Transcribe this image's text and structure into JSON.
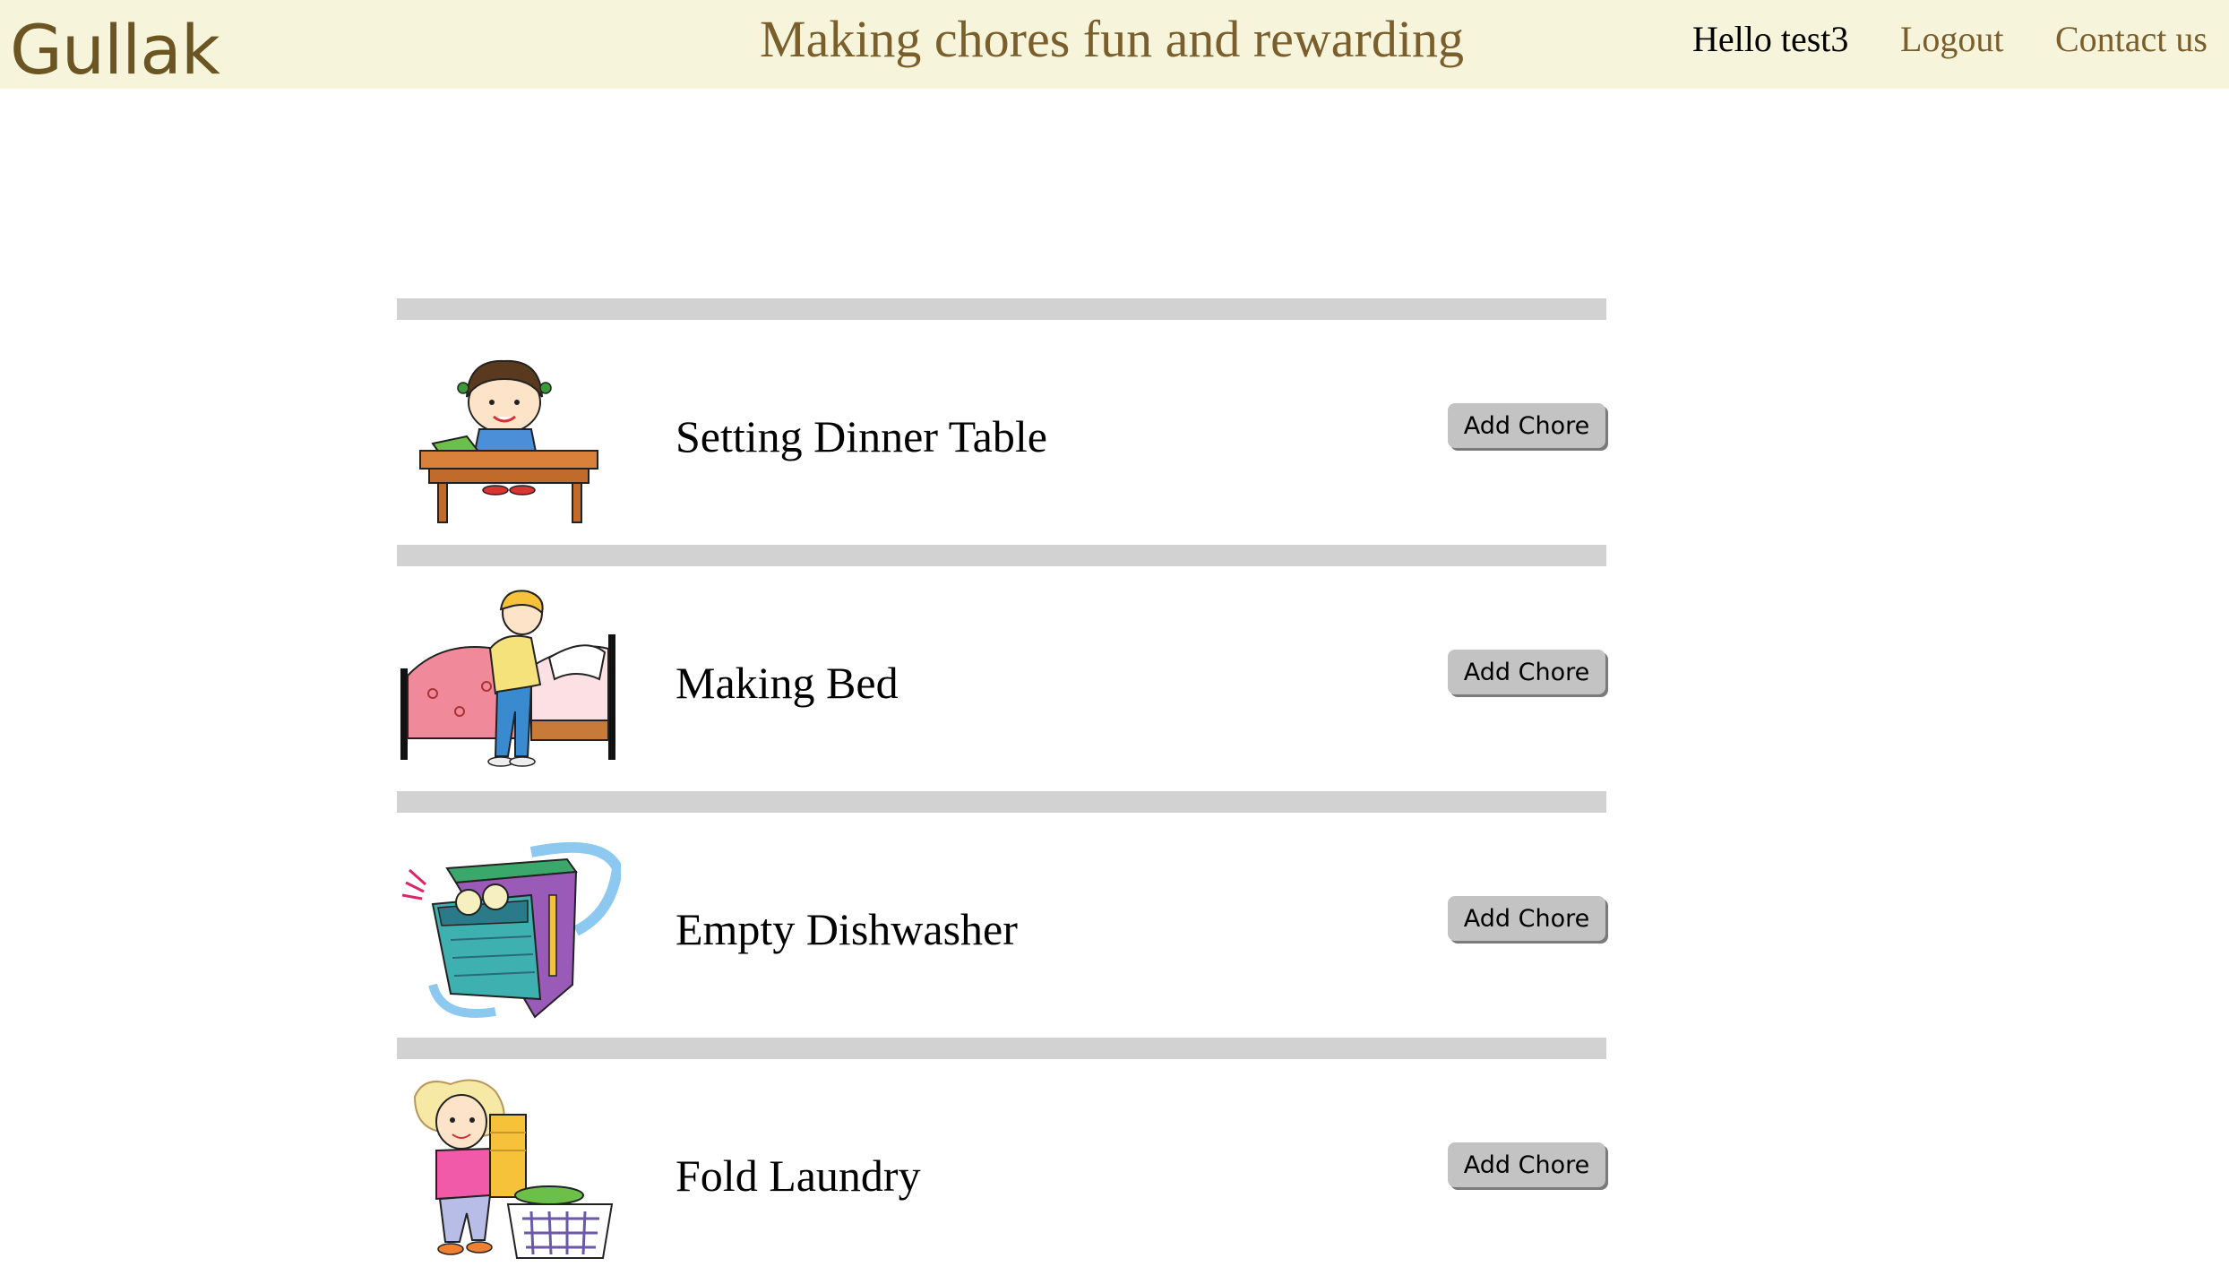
{
  "header": {
    "brand": "Gullak",
    "tagline": "Making chores fun and rewarding",
    "greeting": "Hello test3",
    "logout": "Logout",
    "contact": "Contact us"
  },
  "chores": [
    {
      "name": "Setting Dinner Table",
      "button": "Add Chore",
      "icon": "table-cleaning-girl-icon"
    },
    {
      "name": "Making Bed",
      "button": "Add Chore",
      "icon": "making-bed-girl-icon"
    },
    {
      "name": "Empty Dishwasher",
      "button": "Add Chore",
      "icon": "dishwasher-icon"
    },
    {
      "name": "Fold Laundry",
      "button": "Add Chore",
      "icon": "laundry-girl-icon"
    }
  ],
  "colors": {
    "header_bg": "#f6f5dc",
    "brand": "#6b5523",
    "accent": "#7a5f2c",
    "divider": "#d2d2d2",
    "button": "#c3c3c3"
  }
}
